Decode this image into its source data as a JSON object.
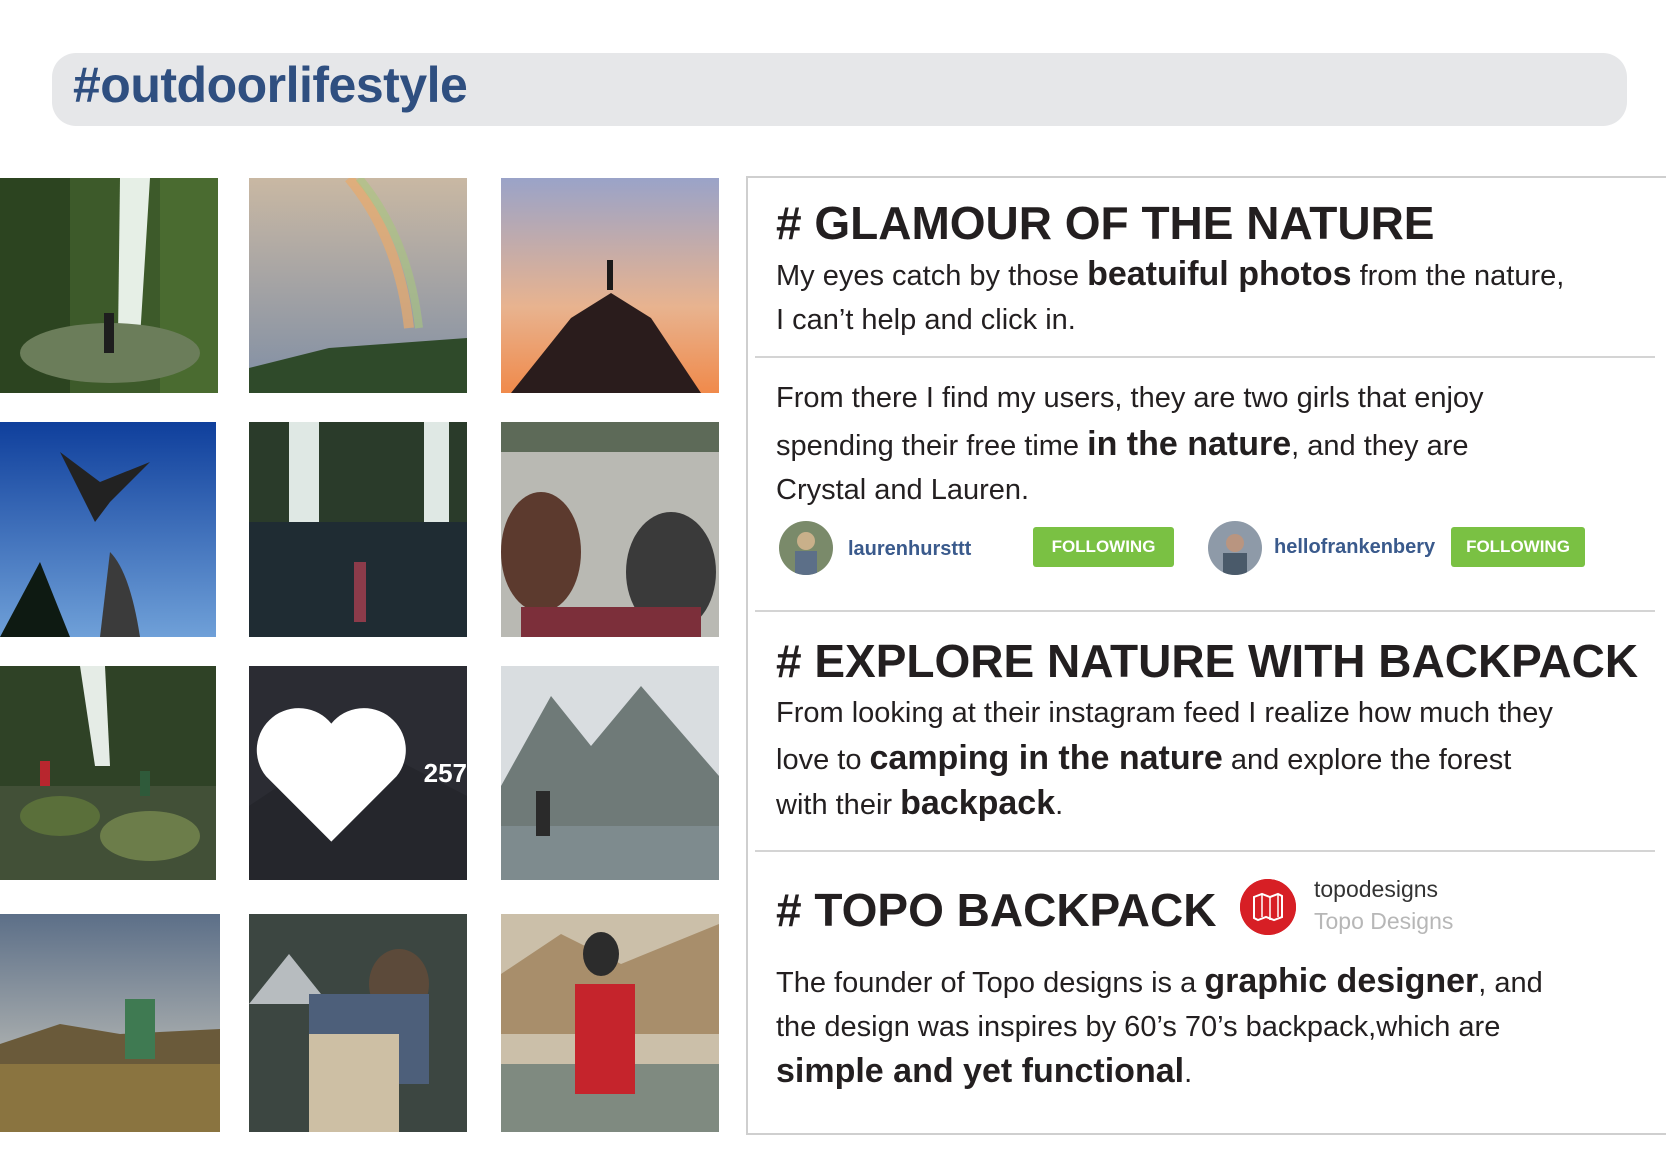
{
  "header": {
    "hashtag": "#outdoorlifestyle"
  },
  "photos": [
    {
      "name": "photo-waterfall-girl"
    },
    {
      "name": "photo-rainbow"
    },
    {
      "name": "photo-sunset-summit"
    },
    {
      "name": "photo-bird-flight"
    },
    {
      "name": "photo-waterfall-lake"
    },
    {
      "name": "photo-picnic-rocks"
    },
    {
      "name": "photo-creek-hikers"
    },
    {
      "name": "photo-likes-dark",
      "likes": "257"
    },
    {
      "name": "photo-mountain-lake"
    },
    {
      "name": "photo-meadow-hiker"
    },
    {
      "name": "photo-backpack-woman"
    },
    {
      "name": "photo-red-backpack"
    }
  ],
  "sections": {
    "glamour": {
      "title": "# GLAMOUR OF THE NATURE",
      "line1_pre": "My eyes catch by those ",
      "line1_bold": "beatuiful photos",
      "line1_post": " from the nature,",
      "line2": "I can’t  help and click in."
    },
    "users": {
      "line1": "From there I find my users, they are two girls that enjoy",
      "line2_pre": "spending their free time ",
      "line2_bold": "in the nature",
      "line2_post": ", and they are",
      "line3": "Crystal and Lauren.",
      "accounts": [
        {
          "username": "laurenhursttt",
          "button": "FOLLOWING"
        },
        {
          "username": "hellofrankenbery",
          "button": "FOLLOWING"
        }
      ]
    },
    "explore": {
      "title": "# EXPLORE NATURE WITH BACKPACK",
      "line1": "From looking at their instagram feed I realize how much they",
      "line2_pre": "love to ",
      "line2_bold": "camping in the nature",
      "line2_post": " and explore the forest",
      "line3_pre": "with their ",
      "line3_bold": "backpack",
      "line3_post": "."
    },
    "topo": {
      "title": "# TOPO BACKPACK",
      "brand_handle": "topodesigns",
      "brand_name": "Topo Designs",
      "line1_pre": "The founder of Topo designs is a ",
      "line1_bold": "graphic designer",
      "line1_post": ", and",
      "line2": "the design was inspires by 60’s 70’s backpack,which are",
      "line3_bold": "simple and yet functional",
      "line3_post": "."
    }
  },
  "colors": {
    "header_bg": "#e6e7e9",
    "hashtag": "#2f4f80",
    "following_button": "#7ac143",
    "username": "#3a5a8c",
    "topo_red": "#d71f25"
  }
}
